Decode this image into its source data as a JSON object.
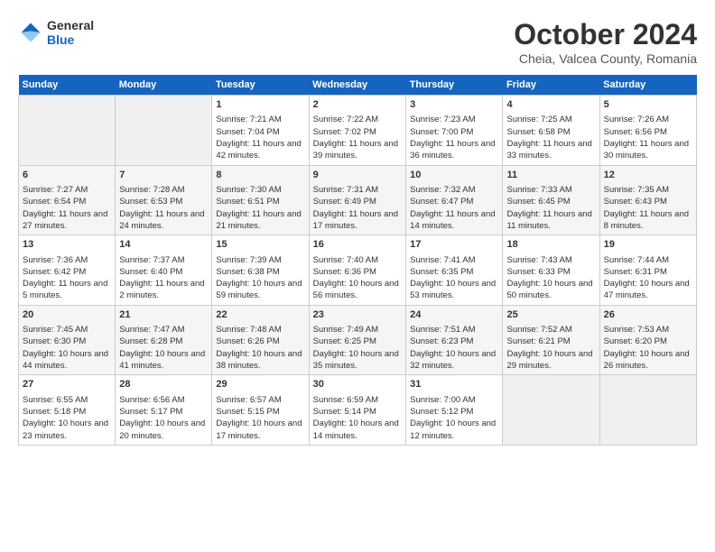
{
  "logo": {
    "general": "General",
    "blue": "Blue"
  },
  "header": {
    "month": "October 2024",
    "location": "Cheia, Valcea County, Romania"
  },
  "days_of_week": [
    "Sunday",
    "Monday",
    "Tuesday",
    "Wednesday",
    "Thursday",
    "Friday",
    "Saturday"
  ],
  "weeks": [
    [
      {
        "day": "",
        "info": ""
      },
      {
        "day": "",
        "info": ""
      },
      {
        "day": "1",
        "sunrise": "7:21 AM",
        "sunset": "7:04 PM",
        "daylight": "11 hours and 42 minutes."
      },
      {
        "day": "2",
        "sunrise": "7:22 AM",
        "sunset": "7:02 PM",
        "daylight": "11 hours and 39 minutes."
      },
      {
        "day": "3",
        "sunrise": "7:23 AM",
        "sunset": "7:00 PM",
        "daylight": "11 hours and 36 minutes."
      },
      {
        "day": "4",
        "sunrise": "7:25 AM",
        "sunset": "6:58 PM",
        "daylight": "11 hours and 33 minutes."
      },
      {
        "day": "5",
        "sunrise": "7:26 AM",
        "sunset": "6:56 PM",
        "daylight": "11 hours and 30 minutes."
      }
    ],
    [
      {
        "day": "6",
        "sunrise": "7:27 AM",
        "sunset": "6:54 PM",
        "daylight": "11 hours and 27 minutes."
      },
      {
        "day": "7",
        "sunrise": "7:28 AM",
        "sunset": "6:53 PM",
        "daylight": "11 hours and 24 minutes."
      },
      {
        "day": "8",
        "sunrise": "7:30 AM",
        "sunset": "6:51 PM",
        "daylight": "11 hours and 21 minutes."
      },
      {
        "day": "9",
        "sunrise": "7:31 AM",
        "sunset": "6:49 PM",
        "daylight": "11 hours and 17 minutes."
      },
      {
        "day": "10",
        "sunrise": "7:32 AM",
        "sunset": "6:47 PM",
        "daylight": "11 hours and 14 minutes."
      },
      {
        "day": "11",
        "sunrise": "7:33 AM",
        "sunset": "6:45 PM",
        "daylight": "11 hours and 11 minutes."
      },
      {
        "day": "12",
        "sunrise": "7:35 AM",
        "sunset": "6:43 PM",
        "daylight": "11 hours and 8 minutes."
      }
    ],
    [
      {
        "day": "13",
        "sunrise": "7:36 AM",
        "sunset": "6:42 PM",
        "daylight": "11 hours and 5 minutes."
      },
      {
        "day": "14",
        "sunrise": "7:37 AM",
        "sunset": "6:40 PM",
        "daylight": "11 hours and 2 minutes."
      },
      {
        "day": "15",
        "sunrise": "7:39 AM",
        "sunset": "6:38 PM",
        "daylight": "10 hours and 59 minutes."
      },
      {
        "day": "16",
        "sunrise": "7:40 AM",
        "sunset": "6:36 PM",
        "daylight": "10 hours and 56 minutes."
      },
      {
        "day": "17",
        "sunrise": "7:41 AM",
        "sunset": "6:35 PM",
        "daylight": "10 hours and 53 minutes."
      },
      {
        "day": "18",
        "sunrise": "7:43 AM",
        "sunset": "6:33 PM",
        "daylight": "10 hours and 50 minutes."
      },
      {
        "day": "19",
        "sunrise": "7:44 AM",
        "sunset": "6:31 PM",
        "daylight": "10 hours and 47 minutes."
      }
    ],
    [
      {
        "day": "20",
        "sunrise": "7:45 AM",
        "sunset": "6:30 PM",
        "daylight": "10 hours and 44 minutes."
      },
      {
        "day": "21",
        "sunrise": "7:47 AM",
        "sunset": "6:28 PM",
        "daylight": "10 hours and 41 minutes."
      },
      {
        "day": "22",
        "sunrise": "7:48 AM",
        "sunset": "6:26 PM",
        "daylight": "10 hours and 38 minutes."
      },
      {
        "day": "23",
        "sunrise": "7:49 AM",
        "sunset": "6:25 PM",
        "daylight": "10 hours and 35 minutes."
      },
      {
        "day": "24",
        "sunrise": "7:51 AM",
        "sunset": "6:23 PM",
        "daylight": "10 hours and 32 minutes."
      },
      {
        "day": "25",
        "sunrise": "7:52 AM",
        "sunset": "6:21 PM",
        "daylight": "10 hours and 29 minutes."
      },
      {
        "day": "26",
        "sunrise": "7:53 AM",
        "sunset": "6:20 PM",
        "daylight": "10 hours and 26 minutes."
      }
    ],
    [
      {
        "day": "27",
        "sunrise": "6:55 AM",
        "sunset": "5:18 PM",
        "daylight": "10 hours and 23 minutes."
      },
      {
        "day": "28",
        "sunrise": "6:56 AM",
        "sunset": "5:17 PM",
        "daylight": "10 hours and 20 minutes."
      },
      {
        "day": "29",
        "sunrise": "6:57 AM",
        "sunset": "5:15 PM",
        "daylight": "10 hours and 17 minutes."
      },
      {
        "day": "30",
        "sunrise": "6:59 AM",
        "sunset": "5:14 PM",
        "daylight": "10 hours and 14 minutes."
      },
      {
        "day": "31",
        "sunrise": "7:00 AM",
        "sunset": "5:12 PM",
        "daylight": "10 hours and 12 minutes."
      },
      {
        "day": "",
        "info": ""
      },
      {
        "day": "",
        "info": ""
      }
    ]
  ],
  "labels": {
    "sunrise": "Sunrise:",
    "sunset": "Sunset:",
    "daylight": "Daylight:"
  }
}
